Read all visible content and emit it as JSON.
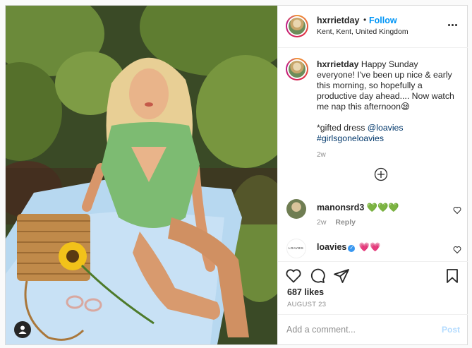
{
  "post": {
    "author": {
      "username": "hxrrietday",
      "follow_label": "Follow",
      "location": "Kent, Kent, United Kingdom"
    },
    "caption": {
      "username": "hxrrietday",
      "text": "Happy Sunday everyone! I've been up nice & early this morning, so hopefully a productive day ahead.... Now watch me nap this afternoon😪",
      "gifted_line_prefix": "*gifted dress ",
      "mention": "@loavies",
      "hashtag": "#girlsgoneloavies",
      "time": "2w"
    },
    "comments": [
      {
        "username": "manonsrd3",
        "text": "💚💚💚",
        "time": "2w",
        "reply_label": "Reply"
      },
      {
        "username": "loavies",
        "verified": true,
        "text": "💗💗",
        "avatar_text": "LOAVIES"
      }
    ],
    "likes": "687 likes",
    "date": "AUGUST 23",
    "add_comment": {
      "placeholder": "Add a comment...",
      "post_label": "Post"
    }
  },
  "icons": {
    "more": "more-icon",
    "load_more": "plus-circle-icon",
    "like": "heart-icon",
    "comment": "comment-icon",
    "share": "share-icon",
    "save": "bookmark-icon",
    "user_tag": "user-tag-icon"
  },
  "colors": {
    "link": "#00376b",
    "follow": "#0095f6",
    "post_disabled": "#b3dbff",
    "secondary_text": "#8e8e8e"
  }
}
